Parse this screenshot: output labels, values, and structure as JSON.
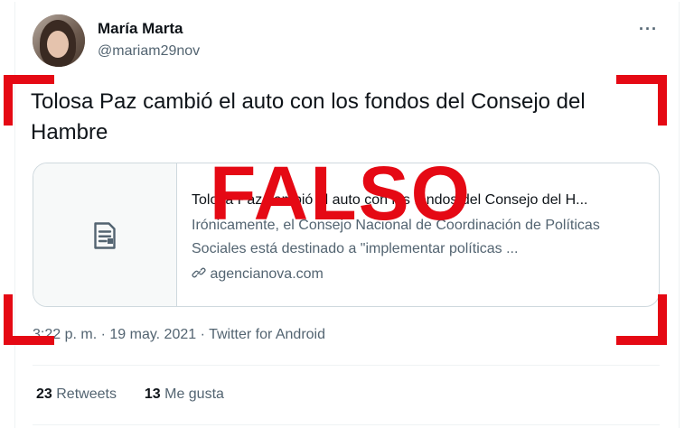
{
  "user": {
    "name": "María Marta",
    "handle": "@mariam29nov"
  },
  "more_label": "···",
  "tweet": {
    "text": "Tolosa Paz cambió el auto con los fondos del Consejo del Hambre"
  },
  "link_card": {
    "title": "Tolosa Paz cambió el auto con los fondos del Consejo del H...",
    "description": "Irónicamente, el Consejo Nacional de Coordinación de Políticas Sociales está destinado a \"implementar políticas ...",
    "domain": "agencianova.com",
    "icon": "document-icon"
  },
  "meta": {
    "text": "3:22 p. m. · 19 may. 2021 · Twitter for Android"
  },
  "stats": {
    "retweets_count": "23",
    "retweets_label": "Retweets",
    "likes_count": "13",
    "likes_label": "Me gusta"
  },
  "overlay": {
    "stamp": "FALSO",
    "color": "#e50914"
  }
}
